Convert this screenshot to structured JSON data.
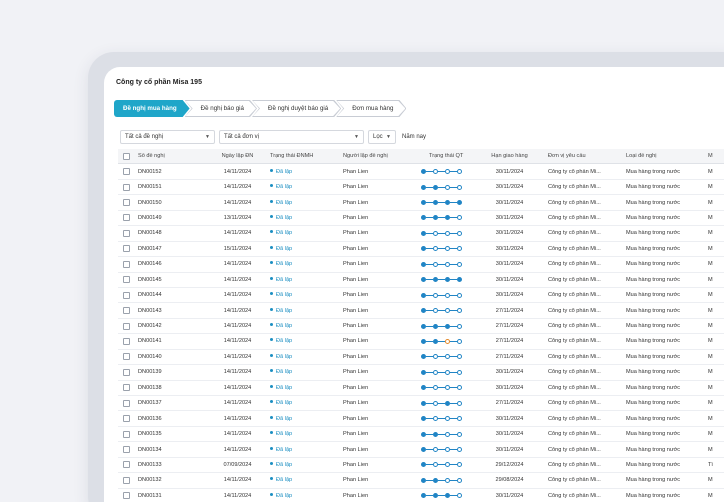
{
  "company": "Công ty cổ phần Misa 195",
  "steps": [
    "Đề nghị mua hàng",
    "Đề nghị báo giá",
    "Đề nghị duyệt báo giá",
    "Đơn mua hàng"
  ],
  "filters": {
    "request": "Tất cả đề nghị",
    "unit": "Tất cả đơn vị",
    "filter": "Lọc",
    "period": "Năm nay"
  },
  "columns": [
    "Số đề nghị",
    "Ngày lập ĐN",
    "Trạng thái ĐNMH",
    "Người lập đề nghị",
    "Trạng thái QT",
    "Hạn giao hàng",
    "Đơn vị yêu cầu",
    "Loại đề nghị",
    "M"
  ],
  "rows": [
    {
      "code": "DN00152",
      "date": "14/11/2024",
      "status": "Đã lập",
      "user": "Phan Lien",
      "qt": "fe ee ee ee",
      "due": "30/11/2024",
      "unit": "Công ty cổ phần Mi...",
      "type": "Mua hàng trong nước",
      "more": "M"
    },
    {
      "code": "DN00151",
      "date": "14/11/2024",
      "status": "Đã lập",
      "user": "Phan Lien",
      "qt": "fe fe ee ee",
      "due": "30/11/2024",
      "unit": "Công ty cổ phần Mi...",
      "type": "Mua hàng trong nước",
      "more": "M"
    },
    {
      "code": "DN00150",
      "date": "14/11/2024",
      "status": "Đã lập",
      "user": "Phan Lien",
      "qt": "fe fe fe fe",
      "due": "30/11/2024",
      "unit": "Công ty cổ phần Mi...",
      "type": "Mua hàng trong nước",
      "more": "M"
    },
    {
      "code": "DN00149",
      "date": "13/11/2024",
      "status": "Đã lập",
      "user": "Phan Lien",
      "qt": "fe fe fe ee",
      "due": "30/11/2024",
      "unit": "Công ty cổ phần Mi...",
      "type": "Mua hàng trong nước",
      "more": "M"
    },
    {
      "code": "DN00148",
      "date": "14/11/2024",
      "status": "Đã lập",
      "user": "Phan Lien",
      "qt": "fe ee ee ee",
      "due": "30/11/2024",
      "unit": "Công ty cổ phần Mi...",
      "type": "Mua hàng trong nước",
      "more": "M"
    },
    {
      "code": "DN00147",
      "date": "15/11/2024",
      "status": "Đã lập",
      "user": "Phan Lien",
      "qt": "fe ee ee ee",
      "due": "30/11/2024",
      "unit": "Công ty cổ phần Mi...",
      "type": "Mua hàng trong nước",
      "more": "M"
    },
    {
      "code": "DN00146",
      "date": "14/11/2024",
      "status": "Đã lập",
      "user": "Phan Lien",
      "qt": "fe ee ee ee",
      "due": "30/11/2024",
      "unit": "Công ty cổ phần Mi...",
      "type": "Mua hàng trong nước",
      "more": "M"
    },
    {
      "code": "DN00145",
      "date": "14/11/2024",
      "status": "Đã lập",
      "user": "Phan Lien",
      "qt": "fe fe fe fe",
      "due": "30/11/2024",
      "unit": "Công ty cổ phần Mi...",
      "type": "Mua hàng trong nước",
      "more": "M"
    },
    {
      "code": "DN00144",
      "date": "14/11/2024",
      "status": "Đã lập",
      "user": "Phan Lien",
      "qt": "fe ee ee ee",
      "due": "30/11/2024",
      "unit": "Công ty cổ phần Mi...",
      "type": "Mua hàng trong nước",
      "more": "M"
    },
    {
      "code": "DN00143",
      "date": "14/11/2024",
      "status": "Đã lập",
      "user": "Phan Lien",
      "qt": "fe ee ee ee",
      "due": "27/11/2024",
      "unit": "Công ty cổ phần Mi...",
      "type": "Mua hàng trong nước",
      "more": "M"
    },
    {
      "code": "DN00142",
      "date": "14/11/2024",
      "status": "Đã lập",
      "user": "Phan Lien",
      "qt": "fe fe fe ee",
      "due": "27/11/2024",
      "unit": "Công ty cổ phần Mi...",
      "type": "Mua hàng trong nước",
      "more": "M"
    },
    {
      "code": "DN00141",
      "date": "14/11/2024",
      "status": "Đã lập",
      "user": "Phan Lien",
      "qt": "fe fe oo ee",
      "due": "27/11/2024",
      "unit": "Công ty cổ phần Mi...",
      "type": "Mua hàng trong nước",
      "more": "M"
    },
    {
      "code": "DN00140",
      "date": "14/11/2024",
      "status": "Đã lập",
      "user": "Phan Lien",
      "qt": "fe ee ee ee",
      "due": "27/11/2024",
      "unit": "Công ty cổ phần Mi...",
      "type": "Mua hàng trong nước",
      "more": "M"
    },
    {
      "code": "DN00139",
      "date": "14/11/2024",
      "status": "Đã lập",
      "user": "Phan Lien",
      "qt": "fe ee ee ee",
      "due": "30/11/2024",
      "unit": "Công ty cổ phần Mi...",
      "type": "Mua hàng trong nước",
      "more": "M"
    },
    {
      "code": "DN00138",
      "date": "14/11/2024",
      "status": "Đã lập",
      "user": "Phan Lien",
      "qt": "fe ee ee ee",
      "due": "30/11/2024",
      "unit": "Công ty cổ phần Mi...",
      "type": "Mua hàng trong nước",
      "more": "M"
    },
    {
      "code": "DN00137",
      "date": "14/11/2024",
      "status": "Đã lập",
      "user": "Phan Lien",
      "qt": "fe ee fe ee",
      "due": "27/11/2024",
      "unit": "Công ty cổ phần Mi...",
      "type": "Mua hàng trong nước",
      "more": "M"
    },
    {
      "code": "DN00136",
      "date": "14/11/2024",
      "status": "Đã lập",
      "user": "Phan Lien",
      "qt": "fe ee ee ee",
      "due": "30/11/2024",
      "unit": "Công ty cổ phần Mi...",
      "type": "Mua hàng trong nước",
      "more": "M"
    },
    {
      "code": "DN00135",
      "date": "14/11/2024",
      "status": "Đã lập",
      "user": "Phan Lien",
      "qt": "fe fe ee ee",
      "due": "30/11/2024",
      "unit": "Công ty cổ phần Mi...",
      "type": "Mua hàng trong nước",
      "more": "M"
    },
    {
      "code": "DN00134",
      "date": "14/11/2024",
      "status": "Đã lập",
      "user": "Phan Lien",
      "qt": "fe ee ee ee",
      "due": "30/11/2024",
      "unit": "Công ty cổ phần Mi...",
      "type": "Mua hàng trong nước",
      "more": "M"
    },
    {
      "code": "DN00133",
      "date": "07/09/2024",
      "status": "Đã lập",
      "user": "Phan Lien",
      "qt": "fe ee ee ee",
      "due": "29/12/2024",
      "unit": "Công ty cổ phần Mi...",
      "type": "Mua hàng trong nước",
      "more": "Tì"
    },
    {
      "code": "DN00132",
      "date": "14/11/2024",
      "status": "Đã lập",
      "user": "Phan Lien",
      "qt": "fe fe ee ee",
      "due": "29/08/2024",
      "unit": "Công ty cổ phần Mi...",
      "type": "Mua hàng trong nước",
      "more": "M"
    },
    {
      "code": "DN00131",
      "date": "14/11/2024",
      "status": "Đã lập",
      "user": "Phan Lien",
      "qt": "fe fe fe ee",
      "due": "30/11/2024",
      "unit": "Công ty cổ phần Mi...",
      "type": "Mua hàng trong nước",
      "more": "M"
    }
  ]
}
